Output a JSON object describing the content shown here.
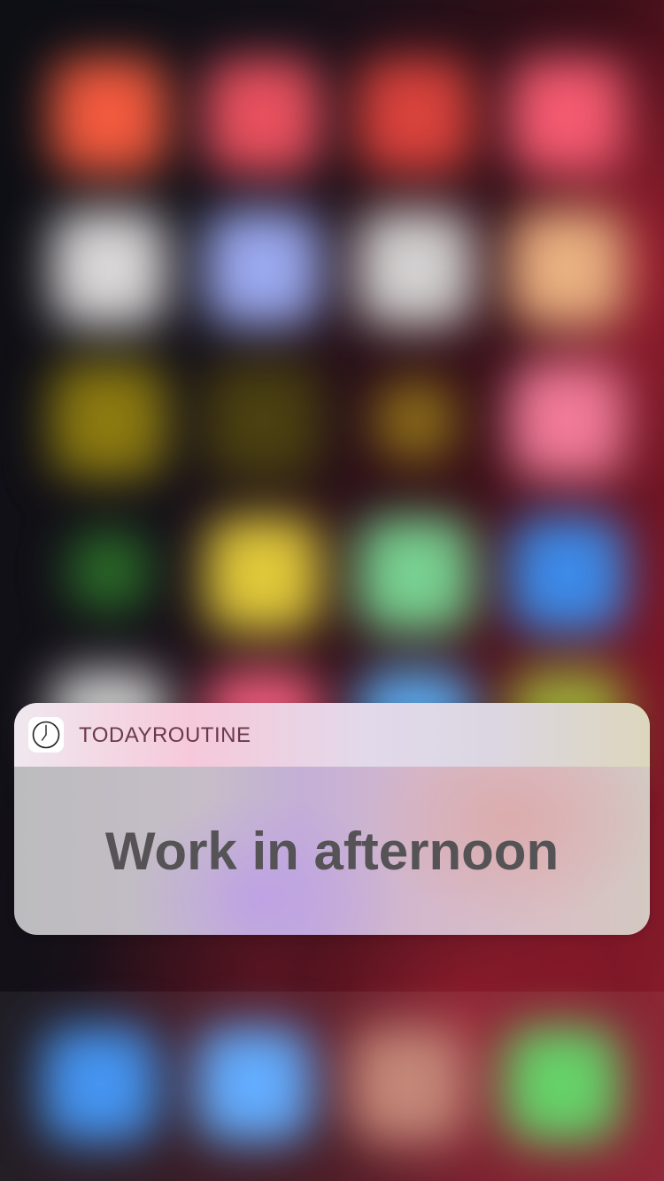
{
  "notification": {
    "app_name": "TODAYROUTINE",
    "app_icon": "clock-icon",
    "message": "Work in afternoon"
  },
  "background": {
    "description_colors": {
      "row1": [
        "#f25a3e",
        "#e8505e",
        "#d9423c",
        "#f45a70"
      ],
      "row2": [
        "#d8d6d6",
        "#9aa8ee",
        "#d2d0d0",
        "#e8b080"
      ],
      "row3": [
        "#8c7a10",
        "#4a4010",
        "#8a6a18",
        "#f07a98"
      ],
      "row4": [
        "#2a6a28",
        "#e0c83a",
        "#78d090",
        "#3c8ae8"
      ],
      "row5": [
        "#c8c8c8",
        "#e85a78",
        "#5aa6e8",
        "#9aa838"
      ],
      "dock": [
        "#3a8ef0",
        "#5aa8ff",
        "#c08070",
        "#5cd060"
      ]
    }
  }
}
